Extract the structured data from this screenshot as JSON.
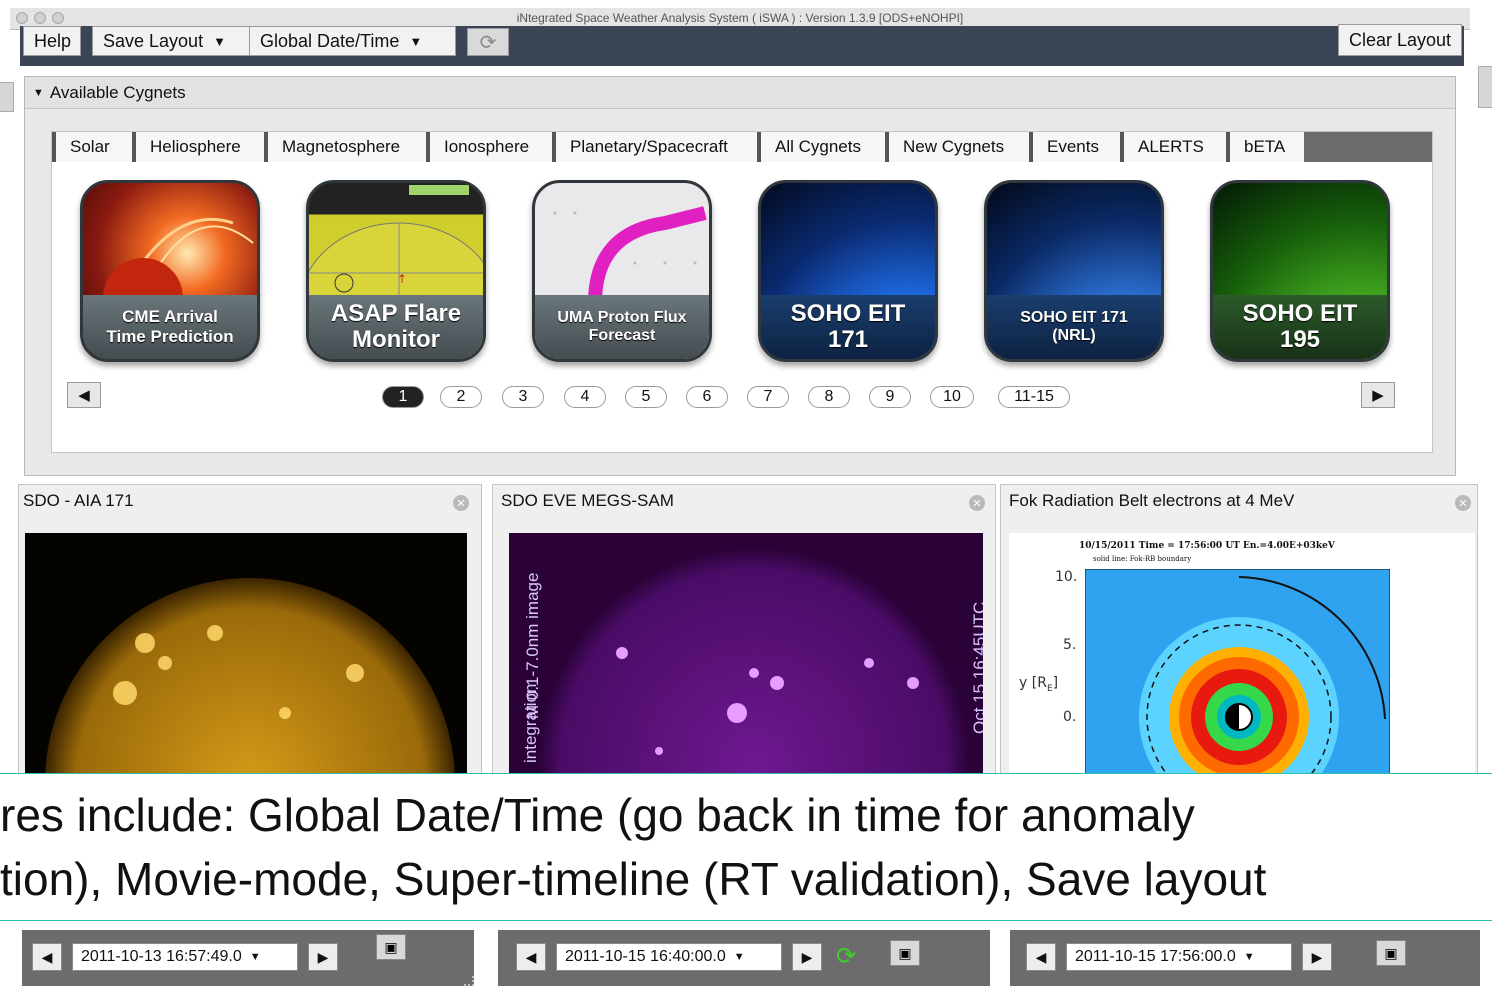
{
  "window": {
    "title": "iNtegrated Space Weather Analysis System ( iSWA ) : Version 1.3.9 [ODS+eNOHPI]"
  },
  "toolbar": {
    "help_label": "Help",
    "save_layout_label": "Save Layout",
    "global_datetime_label": "Global Date/Time",
    "clear_layout_label": "Clear Layout"
  },
  "cygnets": {
    "header": "Available Cygnets",
    "tabs": [
      "Solar",
      "Heliosphere",
      "Magnetosphere",
      "Ionosphere",
      "Planetary/Spacecraft",
      "All Cygnets",
      "New Cygnets",
      "Events",
      "ALERTS",
      "bETA"
    ],
    "tiles": [
      {
        "line1": "CME Arrival",
        "line2": "Time Prediction"
      },
      {
        "line1": "ASAP Flare",
        "line2": "Monitor"
      },
      {
        "line1": "UMA Proton Flux",
        "line2": "Forecast"
      },
      {
        "line1": "SOHO EIT",
        "line2": "171"
      },
      {
        "line1": "SOHO EIT 171",
        "line2": "(NRL)"
      },
      {
        "line1": "SOHO EIT",
        "line2": "195"
      }
    ],
    "pages": [
      "1",
      "2",
      "3",
      "4",
      "5",
      "6",
      "7",
      "8",
      "9",
      "10",
      "11-15"
    ],
    "active_page": "1"
  },
  "panes": [
    {
      "title": "SDO - AIA 171",
      "date": "2011-10-13 16:57:49.0"
    },
    {
      "title": "SDO EVE MEGS-SAM",
      "date": "2011-10-15 16:40:00.0",
      "image_text_1": "M 0.1-7.0nm image",
      "image_text_2": "integration",
      "image_text_3": "Oct 15 16:45UTC"
    },
    {
      "title": "Fok Radiation Belt electrons at 4 MeV",
      "date": "2011-10-15 17:56:00.0",
      "plot_header": "10/15/2011 Time = 17:56:00 UT En.=4.00E+03keV",
      "plot_sub": "solid line: Fok-RB boundary",
      "y_label": "y [R",
      "y_label_sub": "E",
      "y_label_close": "]",
      "ticks": [
        "10.",
        "5.",
        "0."
      ]
    }
  ],
  "overlay": {
    "line1": "res include: Global Date/Time (go back in time for anomaly",
    "line2": "tion), Movie-mode, Super-timeline (RT validation), Save layout"
  },
  "colors": {
    "toolbar_bg": "#3a4655",
    "accent_teal": "#2bbfb0",
    "bottom_bar": "#6c6c6c"
  }
}
